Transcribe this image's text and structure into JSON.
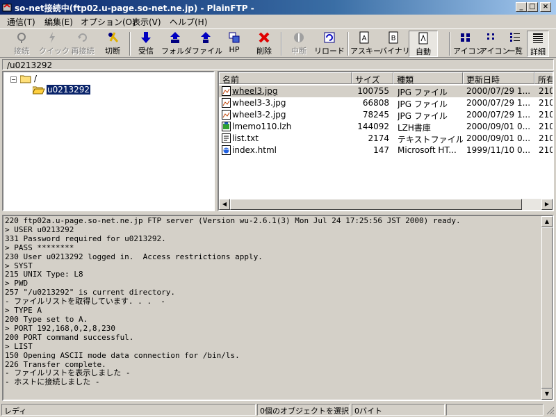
{
  "window": {
    "title": "so-net接続中(ftp02.u-page.so-net.ne.jp) - PlainFTP -",
    "min_label": "_",
    "max_label": "□",
    "close_label": "×"
  },
  "menu": [
    "通信(T)",
    "編集(E)",
    "オプション(O)",
    "表示(V)",
    "ヘルプ(H)"
  ],
  "toolbar": {
    "connect": "接続",
    "quick": "クイック",
    "reconnect": "再接続",
    "disconnect": "切断",
    "receive": "受信",
    "folder": "フォルダ",
    "file": "ファイル",
    "hp": "HP",
    "delete": "削除",
    "abort": "中断",
    "reload": "リロード",
    "ascii": "アスキー",
    "binary": "バイナリ",
    "auto": "自動",
    "large_icon": "アイコン",
    "small_icon": "アイコン",
    "list": "一覧",
    "details": "詳細"
  },
  "path": "/u0213292",
  "tree": {
    "root": "/",
    "expander": "−",
    "child": "u0213292"
  },
  "list": {
    "columns": [
      "名前",
      "サイズ",
      "種類",
      "更新日時",
      "所有"
    ],
    "rows": [
      {
        "name": "wheel3.jpg",
        "size": "100755",
        "type": "JPG ファイル",
        "date": "2000/07/29 1...",
        "owner": "210"
      },
      {
        "name": "wheel3-3.jpg",
        "size": "66808",
        "type": "JPG ファイル",
        "date": "2000/07/29 1...",
        "owner": "210"
      },
      {
        "name": "wheel3-2.jpg",
        "size": "78245",
        "type": "JPG ファイル",
        "date": "2000/07/29 1...",
        "owner": "210"
      },
      {
        "name": "lmemo110.lzh",
        "size": "144092",
        "type": "LZH書庫",
        "date": "2000/09/01 0...",
        "owner": "210"
      },
      {
        "name": "list.txt",
        "size": "2174",
        "type": "テキストファイル",
        "date": "2000/09/01 0...",
        "owner": "210"
      },
      {
        "name": "index.html",
        "size": "147",
        "type": "Microsoft HT...",
        "date": "1999/11/10 0...",
        "owner": "210"
      }
    ]
  },
  "log": [
    "220 ftp02a.u-page.so-net.ne.jp FTP server (Version wu-2.6.1(3) Mon Jul 24 17:25:56 JST 2000) ready.",
    "> USER u0213292",
    "331 Password required for u0213292.",
    "> PASS ********",
    "230 User u0213292 logged in.  Access restrictions apply.",
    "> SYST",
    "215 UNIX Type: L8",
    "> PWD",
    "257 \"/u0213292\" is current directory.",
    "- ファイルリストを取得しています. . .  -",
    "> TYPE A",
    "200 Type set to A.",
    "> PORT 192,168,0,2,8,230",
    "200 PORT command successful.",
    "> LIST",
    "150 Opening ASCII mode data connection for /bin/ls.",
    "226 Transfer complete.",
    "- ファイルリストを表示しました -",
    "- ホストに接続しました -"
  ],
  "status": {
    "ready": "レディ",
    "selected": "0個のオブジェクトを選択",
    "size": "0バイト"
  }
}
